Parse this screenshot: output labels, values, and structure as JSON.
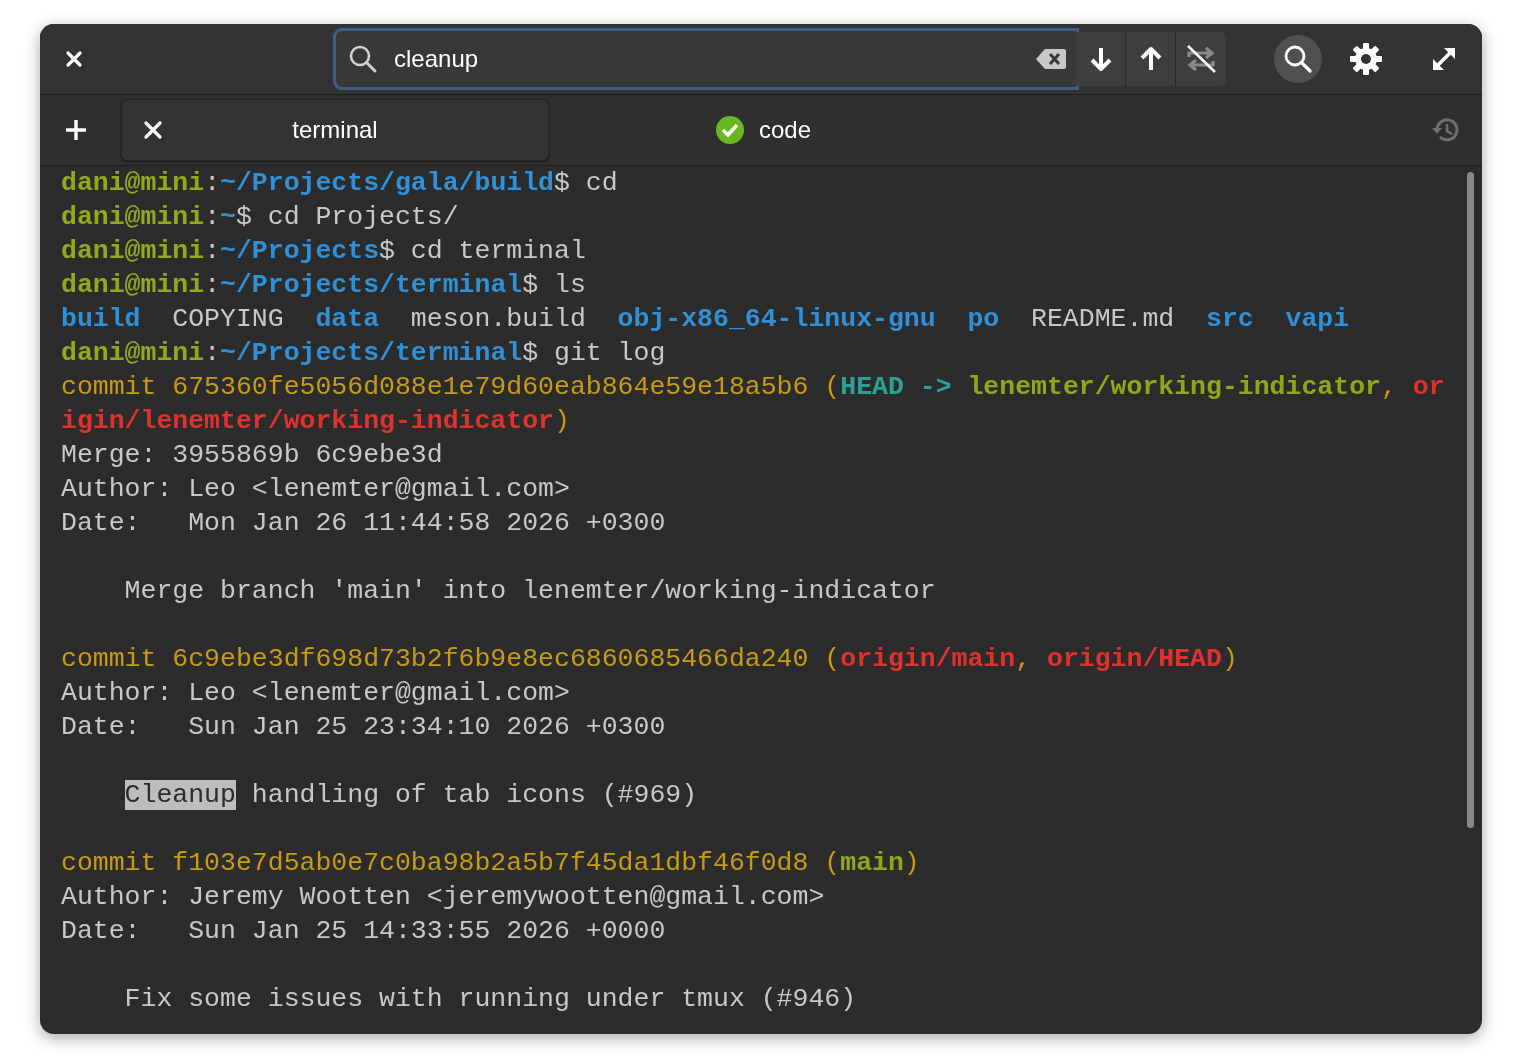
{
  "header": {
    "search": {
      "value": "cleanup",
      "focused": true
    },
    "cycle_enabled": false,
    "search_active": true
  },
  "tabs": [
    {
      "label": "terminal",
      "selected": true,
      "completed": false
    },
    {
      "label": "code",
      "selected": false,
      "completed": true
    }
  ],
  "terminal": {
    "lines": [
      {
        "kind": "text",
        "segments": [
          {
            "kind": "user",
            "text": "dani@mini"
          },
          {
            "kind": "plain",
            "text": ":"
          },
          {
            "kind": "path",
            "text": "~/Projects/gala/build"
          },
          {
            "kind": "plain",
            "text": "$ cd"
          }
        ]
      },
      {
        "kind": "text",
        "segments": [
          {
            "kind": "user",
            "text": "dani@mini"
          },
          {
            "kind": "plain",
            "text": ":"
          },
          {
            "kind": "path",
            "text": "~"
          },
          {
            "kind": "plain",
            "text": "$ cd Projects/"
          }
        ]
      },
      {
        "kind": "text",
        "segments": [
          {
            "kind": "user",
            "text": "dani@mini"
          },
          {
            "kind": "plain",
            "text": ":"
          },
          {
            "kind": "path",
            "text": "~/Projects"
          },
          {
            "kind": "plain",
            "text": "$ cd terminal"
          }
        ]
      },
      {
        "kind": "text",
        "segments": [
          {
            "kind": "user",
            "text": "dani@mini"
          },
          {
            "kind": "plain",
            "text": ":"
          },
          {
            "kind": "path",
            "text": "~/Projects/terminal"
          },
          {
            "kind": "plain",
            "text": "$ ls"
          }
        ]
      },
      {
        "kind": "listing",
        "entries": [
          {
            "kind": "dir",
            "text": "build"
          },
          {
            "kind": "plain",
            "text": "COPYING"
          },
          {
            "kind": "dir",
            "text": "data"
          },
          {
            "kind": "plain",
            "text": "meson.build"
          },
          {
            "kind": "dir",
            "text": "obj-x86_64-linux-gnu"
          },
          {
            "kind": "dir",
            "text": "po"
          },
          {
            "kind": "plain",
            "text": "README.md"
          },
          {
            "kind": "dir",
            "text": "src"
          },
          {
            "kind": "dir",
            "text": "vapi"
          }
        ]
      },
      {
        "kind": "text",
        "segments": [
          {
            "kind": "user",
            "text": "dani@mini"
          },
          {
            "kind": "plain",
            "text": ":"
          },
          {
            "kind": "path",
            "text": "~/Projects/terminal"
          },
          {
            "kind": "plain",
            "text": "$ git log"
          }
        ]
      },
      {
        "kind": "text",
        "segments": [
          {
            "kind": "commit",
            "text": "commit 675360fe5056d088e1e79d60eab864e59e18a5b6 ("
          },
          {
            "kind": "head",
            "text": "HEAD -> "
          },
          {
            "kind": "branch",
            "text": "lenemter/working-indicator"
          },
          {
            "kind": "commit",
            "text": ", "
          },
          {
            "kind": "remote",
            "text": "or"
          }
        ]
      },
      {
        "kind": "text",
        "segments": [
          {
            "kind": "remote",
            "text": "igin/lenemter/working-indicator"
          },
          {
            "kind": "commit",
            "text": ")"
          }
        ]
      },
      {
        "kind": "text",
        "segments": [
          {
            "kind": "plain",
            "text": "Merge: 3955869b 6c9ebe3d"
          }
        ]
      },
      {
        "kind": "text",
        "segments": [
          {
            "kind": "plain",
            "text": "Author: Leo <lenemter@gmail.com>"
          }
        ]
      },
      {
        "kind": "text",
        "segments": [
          {
            "kind": "plain",
            "text": "Date:   Mon Jan 26 11:44:58 2026 +0300"
          }
        ]
      },
      {
        "kind": "text",
        "gap_above": true,
        "indent": true,
        "segments": [
          {
            "kind": "plain",
            "text": "Merge branch 'main' into lenemter/working-indicator"
          }
        ]
      },
      {
        "kind": "text",
        "gap_above": true,
        "segments": [
          {
            "kind": "commit",
            "text": "commit 6c9ebe3df698d73b2f6b9e8ec6860685466da240 ("
          },
          {
            "kind": "remote",
            "text": "origin/main"
          },
          {
            "kind": "commit",
            "text": ", "
          },
          {
            "kind": "remote",
            "text": "origin/HEAD"
          },
          {
            "kind": "commit",
            "text": ")"
          }
        ]
      },
      {
        "kind": "text",
        "segments": [
          {
            "kind": "plain",
            "text": "Author: Leo <lenemter@gmail.com>"
          }
        ]
      },
      {
        "kind": "text",
        "segments": [
          {
            "kind": "plain",
            "text": "Date:   Sun Jan 25 23:34:10 2026 +0300"
          }
        ]
      },
      {
        "kind": "text",
        "gap_above": true,
        "indent": true,
        "segments": [
          {
            "kind": "match",
            "text": "Cleanup"
          },
          {
            "kind": "plain",
            "text": " handling of tab icons (#969)"
          }
        ]
      },
      {
        "kind": "text",
        "gap_above": true,
        "segments": [
          {
            "kind": "commit",
            "text": "commit f103e7d5ab0e7c0ba98b2a5b7f45da1dbf46f0d8 ("
          },
          {
            "kind": "branch",
            "text": "main"
          },
          {
            "kind": "commit",
            "text": ")"
          }
        ]
      },
      {
        "kind": "text",
        "segments": [
          {
            "kind": "plain",
            "text": "Author: Jeremy Wootten <jeremywootten@gmail.com>"
          }
        ]
      },
      {
        "kind": "text",
        "segments": [
          {
            "kind": "plain",
            "text": "Date:   Sun Jan 25 14:33:55 2026 +0000"
          }
        ]
      },
      {
        "kind": "text",
        "gap_above": true,
        "indent": true,
        "segments": [
          {
            "kind": "plain",
            "text": "Fix some issues with running under tmux (#946)"
          }
        ]
      }
    ]
  }
}
